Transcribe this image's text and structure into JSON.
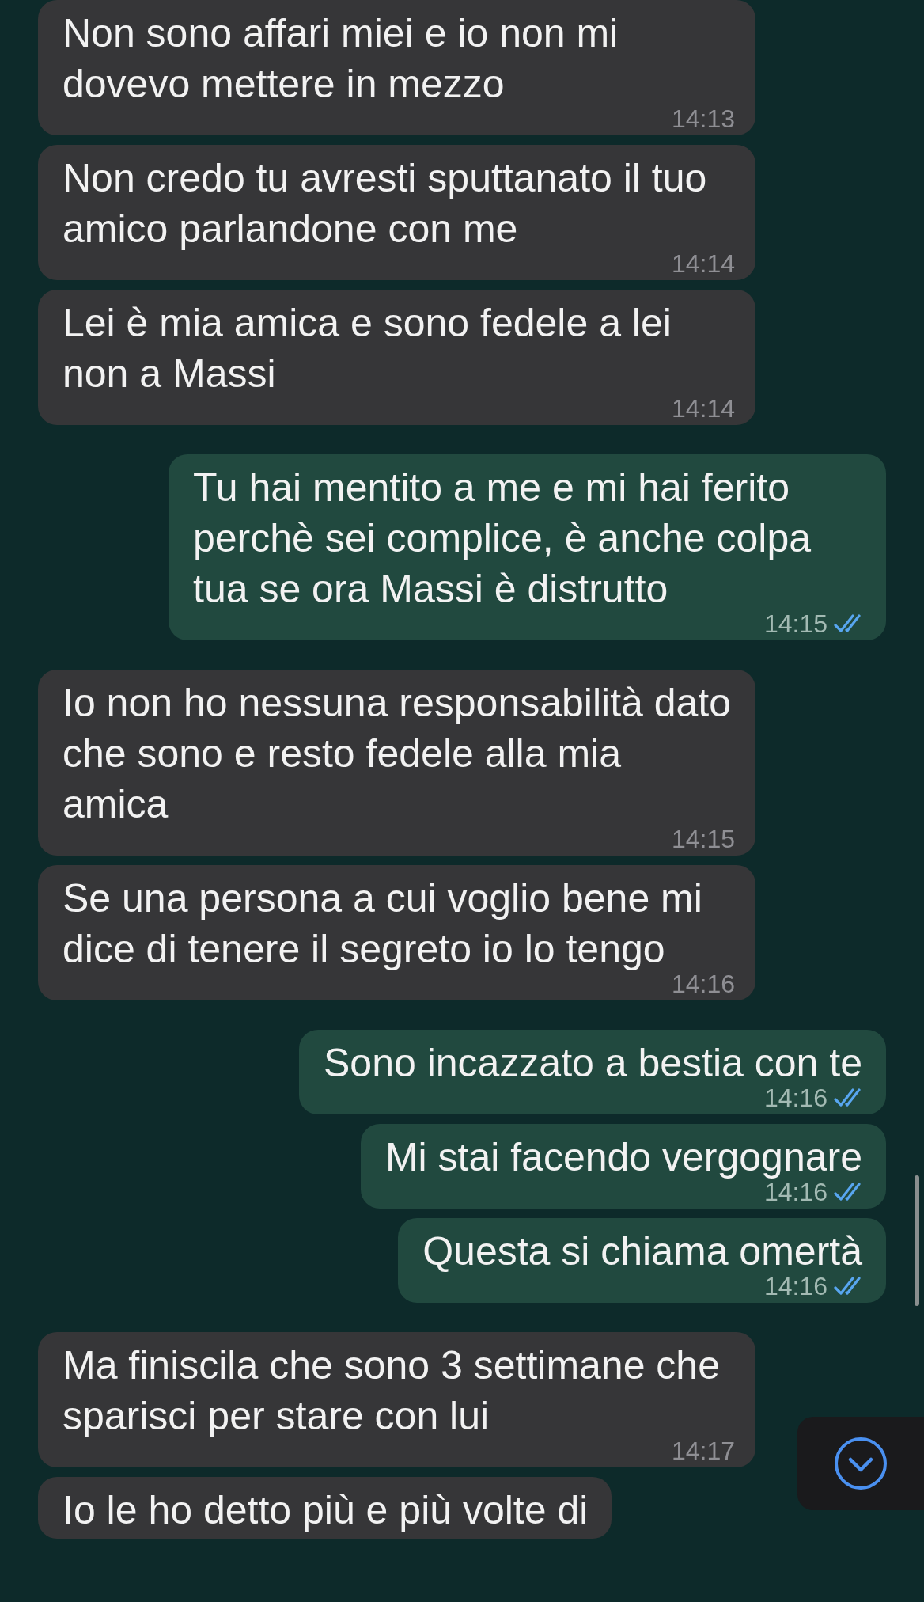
{
  "messages": [
    {
      "kind": "incoming",
      "text": "Non sono affari miei e io non mi dovevo mettere in mezzo",
      "time": "14:13"
    },
    {
      "kind": "incoming",
      "text": "Non credo tu avresti sputtanato il tuo amico parlandone con me",
      "time": "14:14"
    },
    {
      "kind": "incoming",
      "text": "Lei è mia amica e sono fedele a lei non a Massi",
      "time": "14:14"
    },
    {
      "kind": "outgoing",
      "text": "Tu hai mentito a me e mi hai ferito perchè sei complice, è anche colpa tua se ora Massi è distrutto",
      "time": "14:15",
      "read": true
    },
    {
      "kind": "incoming",
      "text": "Io non ho nessuna responsabilità dato che sono e resto fedele alla mia amica",
      "time": "14:15"
    },
    {
      "kind": "incoming",
      "text": "Se una persona a cui voglio bene mi dice di tenere il segreto io lo tengo",
      "time": "14:16"
    },
    {
      "kind": "outgoing",
      "text": "Sono incazzato a bestia con te",
      "time": "14:16",
      "read": true
    },
    {
      "kind": "outgoing",
      "text": "Mi stai facendo vergognare",
      "time": "14:16",
      "read": true
    },
    {
      "kind": "outgoing",
      "text": "Questa si chiama omertà",
      "time": "14:16",
      "read": true
    },
    {
      "kind": "incoming",
      "text": "Ma finiscila che sono 3 settimane che sparisci per stare con lui",
      "time": "14:17"
    },
    {
      "kind": "incoming",
      "text": "Io le ho detto più e più volte di"
    }
  ]
}
